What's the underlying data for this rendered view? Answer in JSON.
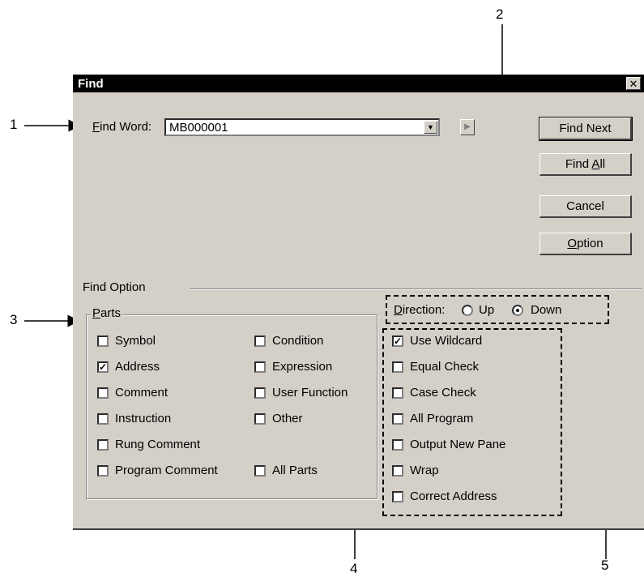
{
  "dialog": {
    "title": "Find",
    "close_glyph": "✕",
    "find_word_label": "Find Word:",
    "find_word_value": "MB000001",
    "combo_arrow_glyph": "▼",
    "small_arrow_glyph": "▶",
    "buttons": {
      "find_next": "Find Next",
      "find_all": "Find All",
      "cancel": "Cancel",
      "option": "Option"
    },
    "find_option_label": "Find Option",
    "parts": {
      "title": "Parts",
      "col1": [
        {
          "label": "Symbol",
          "checked": false
        },
        {
          "label": "Address",
          "checked": true
        },
        {
          "label": "Comment",
          "checked": false
        },
        {
          "label": "Instruction",
          "checked": false
        },
        {
          "label": "Rung Comment",
          "checked": false
        },
        {
          "label": "Program Comment",
          "checked": false
        }
      ],
      "col2": [
        {
          "label": "Condition",
          "checked": false
        },
        {
          "label": "Expression",
          "checked": false
        },
        {
          "label": "User Function",
          "checked": false
        },
        {
          "label": "Other",
          "checked": false
        },
        {
          "label": "All Parts",
          "checked": false
        }
      ]
    },
    "direction": {
      "label": "Direction:",
      "up": "Up",
      "down": "Down",
      "selected": "Down"
    },
    "options": [
      {
        "label": "Use Wildcard",
        "checked": true
      },
      {
        "label": "Equal Check",
        "checked": false
      },
      {
        "label": "Case Check",
        "checked": false
      },
      {
        "label": "All Program",
        "checked": false
      },
      {
        "label": "Output New Pane",
        "checked": false
      },
      {
        "label": "Wrap",
        "checked": false
      },
      {
        "label": "Correct Address",
        "checked": false
      }
    ],
    "check_glyph": "✓"
  },
  "annotations": {
    "n1": "1",
    "n2": "2",
    "n3": "3",
    "n4": "4",
    "n5": "5"
  }
}
